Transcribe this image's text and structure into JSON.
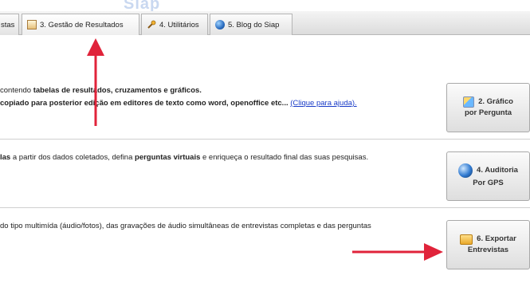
{
  "header": {
    "watermark": "Siap"
  },
  "menu": {
    "tabs": [
      {
        "label": "stas",
        "icon": ""
      },
      {
        "label": "3. Gestão de Resultados",
        "icon": "report-icon",
        "active": true
      },
      {
        "label": "4. Utilitários",
        "icon": "tools-icon"
      },
      {
        "label": "5. Blog do Siap",
        "icon": "globe-icon"
      }
    ]
  },
  "rows": [
    {
      "line1_pre": "contendo ",
      "line1_bold": "tabelas de resultados, cruzamentos e gráficos.",
      "line2_bold": "copiado para posterior edição em editores de texto como word, openoffice etc...",
      "line2_link": "(Clique para ajuda).",
      "button": {
        "line1": "2. Gráfico",
        "line2": "por Pergunta",
        "icon": "chart-icon"
      }
    },
    {
      "line1_bold_a": "las",
      "line1_mid": " a partir dos dados coletados, defina ",
      "line1_bold_b": "perguntas virtuais",
      "line1_post": " e enriqueça o resultado final das suas pesquisas.",
      "button": {
        "line1": "4. Auditoria",
        "line2": "Por GPS",
        "icon": "globe-icon"
      }
    },
    {
      "line1": "do tipo multimída (áudio/fotos), das gravações de áudio simultâneas de entrevistas completas e das perguntas",
      "button": {
        "line1": "6. Exportar",
        "line2": "Entrevistas",
        "icon": "folder-icon"
      }
    }
  ],
  "colors": {
    "arrow": "#e0233a",
    "link": "#1a3cc8"
  }
}
